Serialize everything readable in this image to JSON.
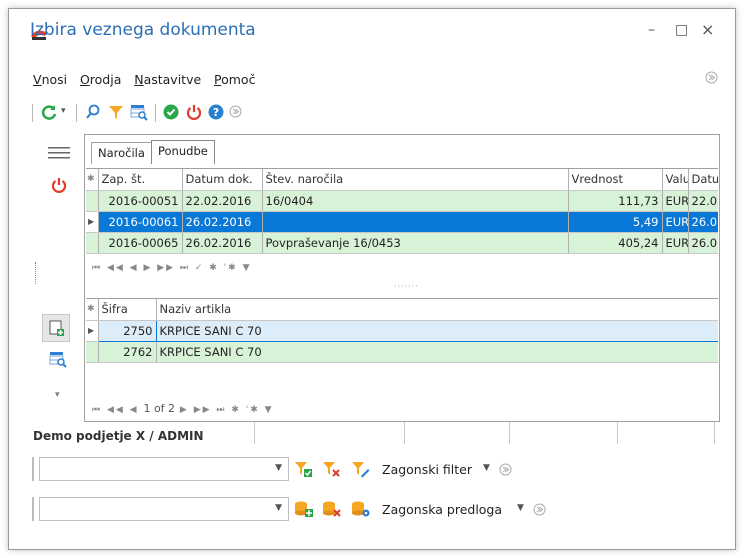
{
  "window": {
    "title": "Izbira veznega dokumenta",
    "minimize": "–",
    "maximize": "□",
    "close": "×"
  },
  "menu": [
    "Vnosi",
    "Orodja",
    "Nastavitve",
    "Pomoč"
  ],
  "tabs": [
    "Naročila",
    "Ponudbe"
  ],
  "orders": {
    "columns": [
      "Zap. št.",
      "Datum dok.",
      "Štev. naročila",
      "Vrednost",
      "Valu",
      "Datu"
    ],
    "rows": [
      {
        "zap": "2016-00051",
        "datum": "22.02.2016",
        "stev": "16/0404",
        "vrednost": "111,73",
        "valuta": "EUR",
        "datu": "22.0"
      },
      {
        "zap": "2016-00061",
        "datum": "26.02.2016",
        "stev": "",
        "vrednost": "5,49",
        "valuta": "EUR",
        "datu": "26.0"
      },
      {
        "zap": "2016-00065",
        "datum": "26.02.2016",
        "stev": "Povpraševanje 16/0453",
        "vrednost": "405,24",
        "valuta": "EUR",
        "datu": "26.0"
      }
    ]
  },
  "articles": {
    "columns": [
      "Šifra",
      "Naziv artikla"
    ],
    "rows": [
      {
        "sifra": "2750",
        "naziv": "KRPICE SANI C 70"
      },
      {
        "sifra": "2762",
        "naziv": "KRPICE SANI C 70"
      }
    ],
    "pager": "1 of 2"
  },
  "status": {
    "company": "Demo podjetje X / ADMIN"
  },
  "filter": {
    "label": "Zagonski filter"
  },
  "template": {
    "label": "Zagonska predloga"
  },
  "colors": {
    "accent": "#2a6fb3",
    "selected_row": "#0a78d7",
    "green_row": "#d8f2d8",
    "blue_row": "#dcecf8",
    "power_red": "#e23a2a",
    "ok_green": "#2aa64a"
  }
}
